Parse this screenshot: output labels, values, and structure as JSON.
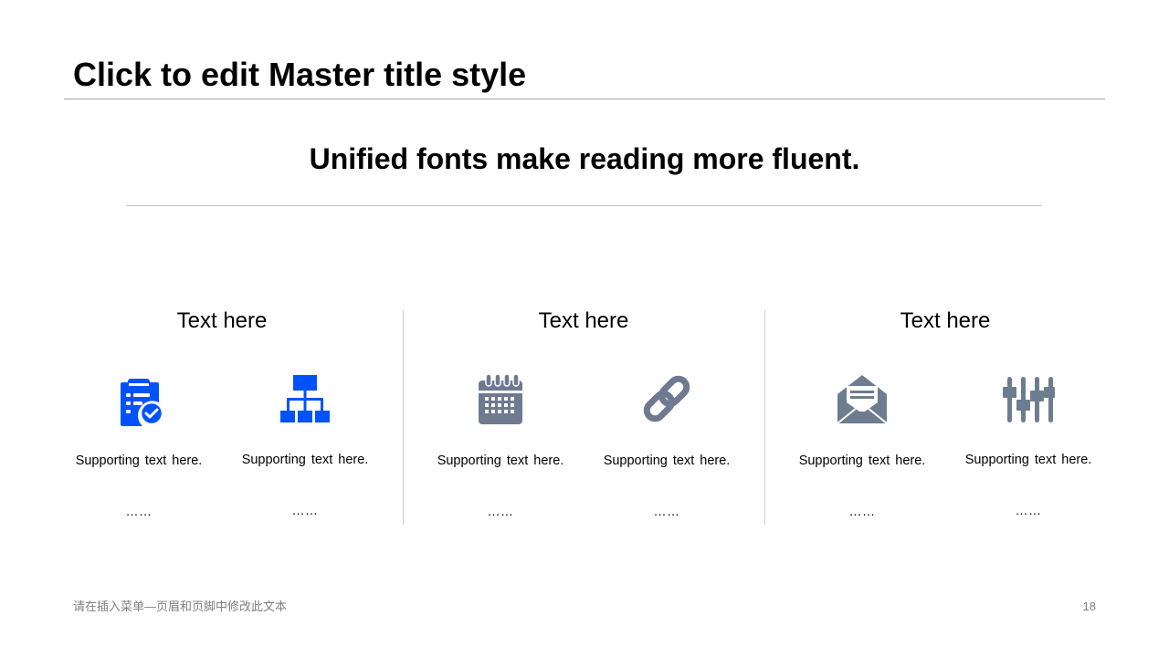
{
  "slide": {
    "title": "Click to edit Master title style",
    "subtitle": "Unified fonts make reading more fluent."
  },
  "groups": [
    {
      "title": "Text here",
      "items": [
        {
          "icon": "clipboard-check-icon",
          "color": "#0052ff",
          "text": "Supporting text here.",
          "dots": "……"
        },
        {
          "icon": "org-chart-icon",
          "color": "#0052ff",
          "text": "Supporting text here.",
          "dots": "……"
        }
      ]
    },
    {
      "title": "Text here",
      "items": [
        {
          "icon": "calendar-icon",
          "color": "#6f7a91",
          "text": "Supporting text here.",
          "dots": "……"
        },
        {
          "icon": "link-icon",
          "color": "#6f7a91",
          "text": "Supporting text here.",
          "dots": "……"
        }
      ]
    },
    {
      "title": "Text here",
      "items": [
        {
          "icon": "open-envelope-icon",
          "color": "#6d7d8f",
          "text": "Supporting text here.",
          "dots": "……"
        },
        {
          "icon": "sliders-icon",
          "color": "#6d7d8f",
          "text": "Supporting text here.",
          "dots": "……"
        }
      ]
    }
  ],
  "footer": {
    "text": "请在插入菜单—页眉和页脚中修改此文本",
    "page_number": "18"
  }
}
